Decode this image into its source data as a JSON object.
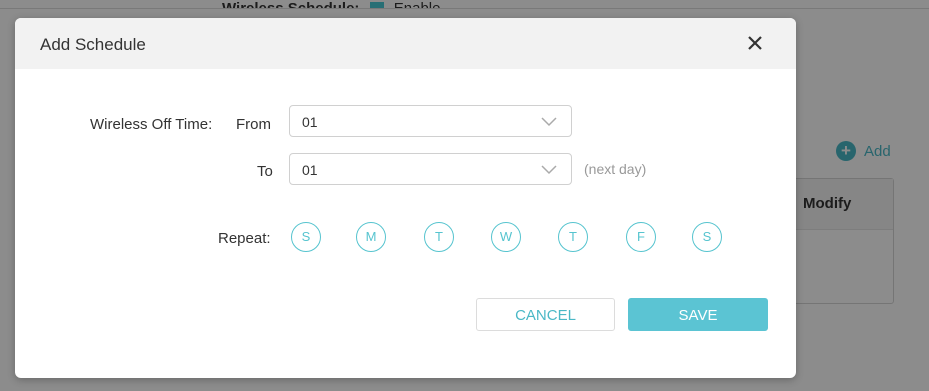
{
  "background": {
    "schedule_label": "Wireless Schedule:",
    "schedule_enable": "Enable",
    "add_label": "Add",
    "table_header_modify": "Modify"
  },
  "dialog": {
    "title": "Add Schedule",
    "close_icon": "close-icon",
    "off_time_label": "Wireless Off Time:",
    "from_label": "From",
    "from_value": "01",
    "to_label": "To",
    "to_value": "01",
    "next_day_hint": "(next day)",
    "repeat_label": "Repeat:",
    "days": [
      "S",
      "M",
      "T",
      "W",
      "T",
      "F",
      "S"
    ],
    "cancel_label": "CANCEL",
    "save_label": "SAVE"
  },
  "colors": {
    "accent": "#56c4cf",
    "save_bg": "#5bc4d3",
    "header_bg": "#f2f2f2"
  }
}
